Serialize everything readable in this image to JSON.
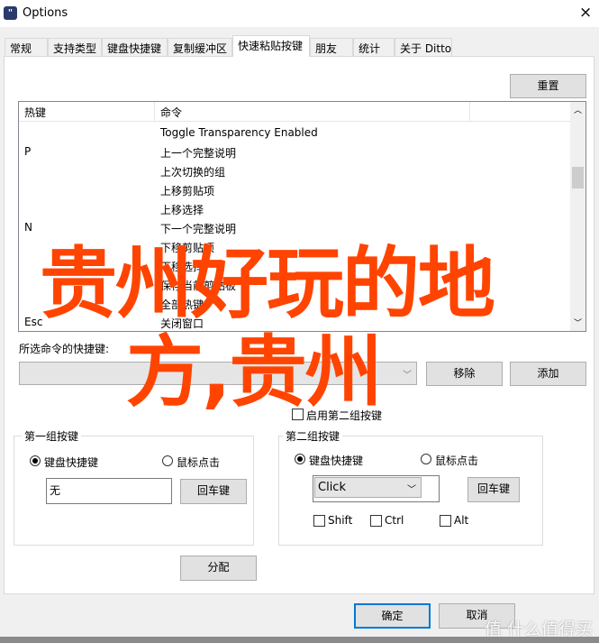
{
  "window": {
    "title": "Options",
    "icon": "ditto-app-icon",
    "close": "×"
  },
  "tabs": [
    {
      "label": "常规"
    },
    {
      "label": "支持类型"
    },
    {
      "label": "键盘快捷键"
    },
    {
      "label": "复制缓冲区"
    },
    {
      "label": "快速粘贴按键",
      "active": true
    },
    {
      "label": "朋友"
    },
    {
      "label": "统计"
    },
    {
      "label": "关于 Ditto"
    }
  ],
  "reset_label": "重置",
  "list": {
    "headers": [
      "热键",
      "命令"
    ],
    "rows": [
      {
        "key": "",
        "cmd": "Toggle Transparency Enabled"
      },
      {
        "key": "P",
        "cmd": "上一个完整说明"
      },
      {
        "key": "",
        "cmd": "上次切换的组"
      },
      {
        "key": "",
        "cmd": "上移剪贴项"
      },
      {
        "key": "",
        "cmd": "上移选择"
      },
      {
        "key": "N",
        "cmd": "下一个完整说明"
      },
      {
        "key": "",
        "cmd": "下移剪贴项"
      },
      {
        "key": "",
        "cmd": "下移选择"
      },
      {
        "key": "",
        "cmd": "保存当前剪贴板"
      },
      {
        "key": "",
        "cmd": "全部热键"
      },
      {
        "key": "Esc",
        "cmd": "关闭窗口"
      }
    ]
  },
  "selected_hotkey_label": "所选命令的快捷键:",
  "selected_hotkey_value": "",
  "remove_label": "移除",
  "add_label": "添加",
  "enable_second_label": "启用第二组按键",
  "group1": {
    "title": "第一组按键",
    "radio_keyboard": "键盘快捷键",
    "radio_mouse": "鼠标点击",
    "value": "无",
    "enter_label": "回车键"
  },
  "group2": {
    "title": "第二组按键",
    "radio_keyboard": "键盘快捷键",
    "radio_mouse": "鼠标点击",
    "select_value": "Click",
    "enter_label": "回车键",
    "shift": "Shift",
    "ctrl": "Ctrl",
    "alt": "Alt"
  },
  "assign_label": "分配",
  "ok_label": "确定",
  "cancel_label": "取消",
  "overlay": {
    "line1": "贵州好玩的地",
    "line2": "方,贵州",
    "color": "#ff4400"
  },
  "watermark": "值 什么值得买"
}
